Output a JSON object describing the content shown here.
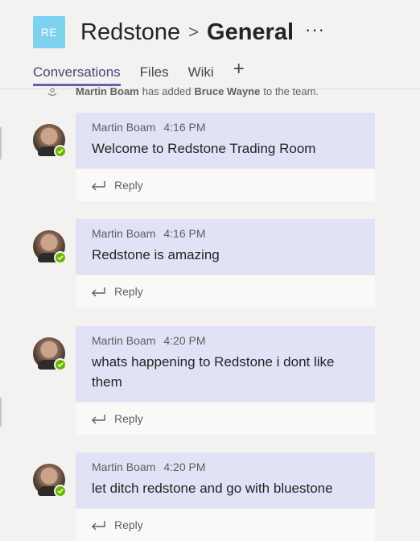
{
  "header": {
    "team_initials": "RE",
    "team_name": "Redstone",
    "separator": ">",
    "channel_name": "General",
    "more_label": "···"
  },
  "tabs": [
    {
      "label": "Conversations",
      "active": true
    },
    {
      "label": "Files",
      "active": false
    },
    {
      "label": "Wiki",
      "active": false
    }
  ],
  "add_tab_label": "+",
  "system_message": {
    "actor": "Martin Boam",
    "action": "has added",
    "target": "Bruce Wayne",
    "suffix": "to the team."
  },
  "reply_label": "Reply",
  "messages": [
    {
      "author": "Martin Boam",
      "time": "4:16 PM",
      "text": "Welcome to Redstone Trading Room"
    },
    {
      "author": "Martin Boam",
      "time": "4:16 PM",
      "text": "Redstone is amazing"
    },
    {
      "author": "Martin Boam",
      "time": "4:20 PM",
      "text": "whats happening to Redstone i dont like them"
    },
    {
      "author": "Martin Boam",
      "time": "4:20 PM",
      "text": "let ditch redstone and go with bluestone"
    }
  ],
  "colors": {
    "accent": "#6264a7",
    "message_bg": "#e2e2f6",
    "status_available": "#6bb700",
    "team_tile": "#7fd1f0"
  }
}
